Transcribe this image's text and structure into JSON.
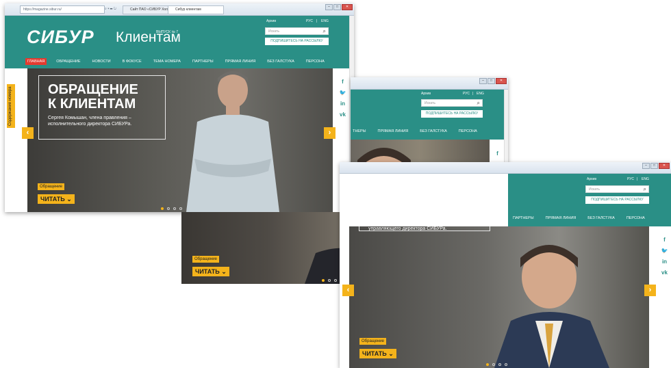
{
  "browser": {
    "address": "https://magazine.sibur.ru/",
    "address_tools": "⌕ ▾ ☰ ↻",
    "tab_inactive": "Сайт ПАО «СИБУР Холдинг»",
    "tab_active": "Сибур клиентам",
    "win_min": "–",
    "win_max": "□",
    "win_close": "✕"
  },
  "site": {
    "logo_bold": "СИБУР",
    "logo_light": "Клиентам",
    "issue": "ВЫПУСК № 7",
    "archive": "Архив",
    "lang_ru": "РУС",
    "lang_sep": "|",
    "lang_en": "ENG",
    "search_placeholder": "Искать",
    "subscribe": "ПОДПИШИТЕСЬ НА РАССЫЛКУ"
  },
  "nav": [
    "ГЛАВНАЯ",
    "ОБРАЩЕНИЕ",
    "НОВОСТИ",
    "В ФОКУСЕ",
    "ТЕМА НОМЕРА",
    "ПАРТНЕРЫ",
    "ПРЯМАЯ ЛИНИЯ",
    "БЕЗ ГАЛСТУКА",
    "ПЕРСОНА"
  ],
  "nav_partial": [
    "ТНЕРЫ",
    "ПРЯМАЯ ЛИНИЯ",
    "БЕЗ ГАЛСТУКА",
    "ПЕРСОНА"
  ],
  "nav_partial3": [
    "ПАРТНЕРЫ",
    "ПРЯМАЯ ЛИНИЯ",
    "БЕЗ ГАЛСТУКА",
    "ПЕРСОНА"
  ],
  "sidetab": "Содержание номера",
  "hero": {
    "title_line1": "ОБРАЩЕНИЕ",
    "title_line2": "К КЛИЕНТАМ",
    "subtitle": "Сергея Комышан, члена правления – исполнительного директора СИБУРа.",
    "subtitle_slide3": "управляющего директора СИБУРа.",
    "badge": "Обращение",
    "read": "ЧИТАТЬ",
    "chevron": "⌄",
    "prev": "‹",
    "next": "›"
  },
  "social": [
    "f",
    "🐦",
    "in",
    "vk"
  ],
  "colors": {
    "teal": "#2a8f86",
    "accent": "#f4b31b",
    "nav_active": "#e33b30"
  }
}
